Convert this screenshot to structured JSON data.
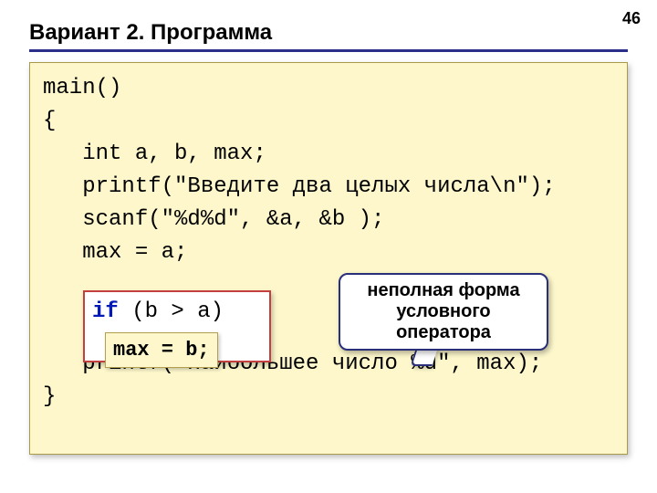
{
  "page_number": "46",
  "title": "Вариант 2. Программа",
  "code": {
    "line1": "main()",
    "line2": "{",
    "line3": "   int a, b, max;",
    "line4": "   printf(\"Введите два целых числа\\n\");",
    "line5": "   scanf(\"%d%d\", &a, &b );",
    "line6": "   max = a;",
    "blank_gap": "",
    "line8": "   printf(\"Наибольшее число %d\", max);",
    "line9": "}"
  },
  "highlight": {
    "if_kw": "if",
    "cond": " (b > a)",
    "stmt": "max = b;"
  },
  "callout": {
    "line1": "неполная форма",
    "line2": "условного",
    "line3": "оператора"
  }
}
